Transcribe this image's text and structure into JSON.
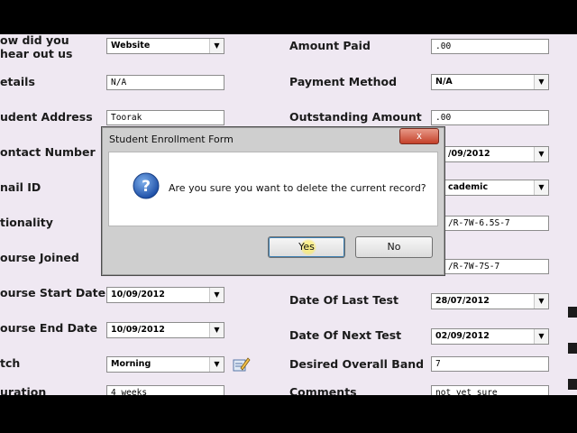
{
  "dialog": {
    "title": "Student Enrollment Form",
    "close": "x",
    "message": "Are you sure you want to delete the current record?",
    "yes": "Yes",
    "no": "No"
  },
  "left": {
    "hear_label": "ow did you hear out us",
    "hear_value": "Website",
    "details_label": "etails",
    "details_value": "N/A",
    "address_label": "udent Address",
    "address_value": "Toorak",
    "contact_label": "ontact Number",
    "email_label": "nail ID",
    "nationality_label": "tionality",
    "course_joined_label": "ourse Joined",
    "start_label": "ourse Start Date",
    "start_value": "10/09/2012",
    "end_label": "ourse End Date",
    "end_value": "10/09/2012",
    "batch_label": "tch",
    "batch_value": "Morning",
    "duration_label": "uration",
    "duration_value": "4 weeks"
  },
  "right": {
    "amount_label": "Amount Paid",
    "amount_value": ".00",
    "method_label": "Payment Method",
    "method_value": "N/A",
    "outstanding_label": "Outstanding Amount",
    "outstanding_value": ".00",
    "date_partial": "/09/2012",
    "module_partial": "cademic",
    "score1_partial": "/R-7W-6.5S-7",
    "score2_partial": "/R-7W-7S-7",
    "last_test_label": "Date Of Last Test",
    "last_test_value": "28/07/2012",
    "next_test_label": "Date Of Next Test",
    "next_test_value": "02/09/2012",
    "band_label": "Desired Overall Band",
    "band_value": "7",
    "comments_label": "Comments",
    "comments_value": "not yet sure"
  }
}
